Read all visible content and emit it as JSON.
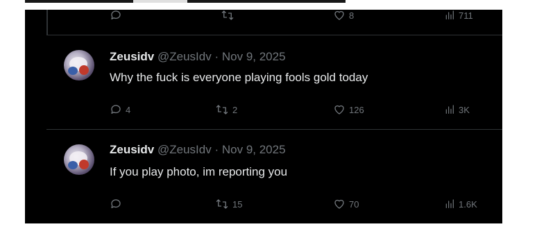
{
  "partial_tweet": {
    "replies": "",
    "retweets": "",
    "likes": "8",
    "views": "711"
  },
  "tweets": [
    {
      "name": "Zeusidv",
      "handle": "@ZeusIdv",
      "separator": "·",
      "date": "Nov 9, 2025",
      "text": "Why the fuck is everyone playing fools gold today",
      "replies": "4",
      "retweets": "2",
      "likes": "126",
      "views": "3K"
    },
    {
      "name": "Zeusidv",
      "handle": "@ZeusIdv",
      "separator": "·",
      "date": "Nov 9, 2025",
      "text": "If you play photo, im reporting you",
      "replies": "",
      "retweets": "15",
      "likes": "70",
      "views": "1.6K"
    }
  ],
  "icons": {
    "reply": "reply-icon",
    "retweet": "retweet-icon",
    "like": "heart-icon",
    "views": "views-icon"
  },
  "colors": {
    "background": "#000000",
    "primary_text": "#e7e9ea",
    "secondary_text": "#71767b",
    "divider": "#2f3336"
  }
}
